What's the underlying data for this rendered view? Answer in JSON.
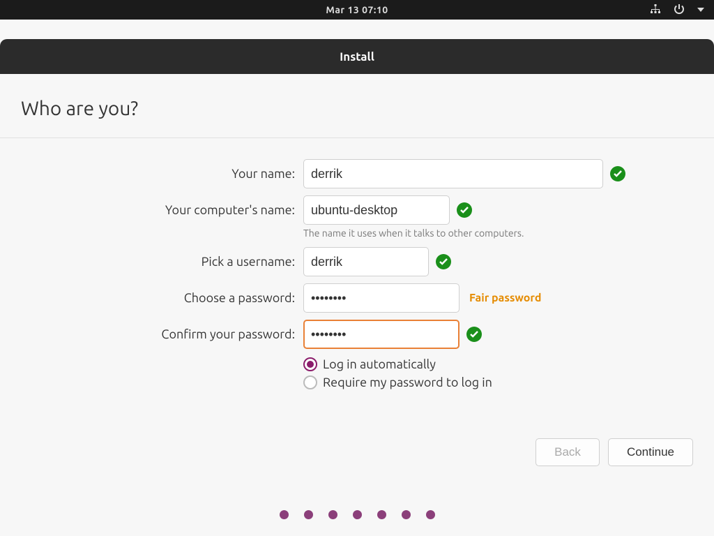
{
  "topbar": {
    "clock": "Mar 13  07:10"
  },
  "window": {
    "title": "Install"
  },
  "page": {
    "heading": "Who are you?"
  },
  "form": {
    "name": {
      "label": "Your name:",
      "value": "derrik"
    },
    "host": {
      "label": "Your computer's name:",
      "value": "ubuntu-desktop",
      "hint": "The name it uses when it talks to other computers."
    },
    "user": {
      "label": "Pick a username:",
      "value": "derrik"
    },
    "pass": {
      "label": "Choose a password:",
      "value": "••••••••",
      "strength": "Fair password"
    },
    "confirm": {
      "label": "Confirm your password:",
      "value": "••••••••"
    },
    "login_auto": "Log in automatically",
    "login_require": "Require my password to log in"
  },
  "buttons": {
    "back": "Back",
    "continue": "Continue"
  },
  "progress_dots": 7
}
